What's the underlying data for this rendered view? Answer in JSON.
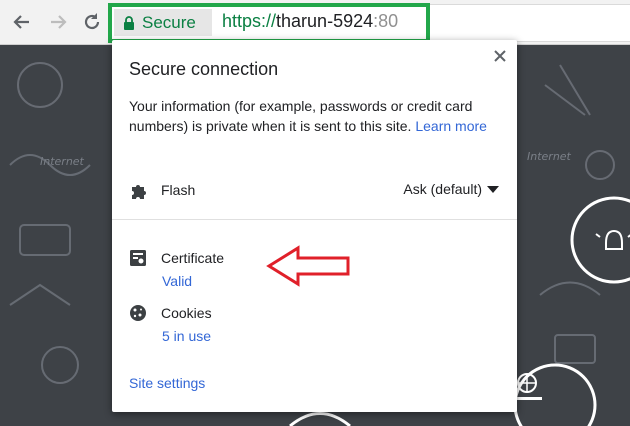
{
  "toolbar": {
    "back_icon": "arrow-left-icon",
    "forward_icon": "arrow-right-icon",
    "reload_icon": "reload-icon",
    "security_chip": {
      "icon": "lock-icon",
      "label": "Secure",
      "color": "#0b8043"
    },
    "url": {
      "scheme": "https://",
      "host": "tharun-5924",
      "port": ":80"
    },
    "highlight_color": "#22a74a"
  },
  "popup": {
    "title": "Secure connection",
    "close_icon": "close-icon",
    "info_text": "Your information (for example, passwords or credit card numbers) is private when it is sent to this site.",
    "learn_more": "Learn more",
    "permissions": [
      {
        "icon": "puzzle-icon",
        "label": "Flash",
        "value": "Ask (default)"
      }
    ],
    "certificate": {
      "icon": "certificate-icon",
      "label": "Certificate",
      "status": "Valid"
    },
    "cookies": {
      "icon": "cookie-icon",
      "label": "Cookies",
      "status": "5 in use"
    },
    "site_settings": "Site settings",
    "link_color": "#3367d6"
  },
  "annotation": {
    "arrow_color": "#e0202a"
  }
}
